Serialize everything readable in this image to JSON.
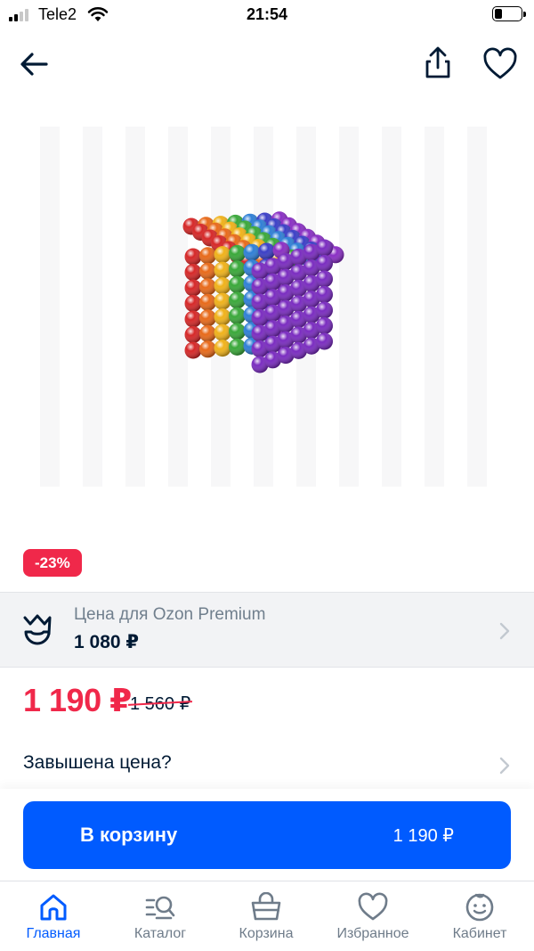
{
  "status_bar": {
    "carrier": "Tele2",
    "time": "21:54",
    "battery_level": 0.3
  },
  "top_bar": {
    "back_icon": "arrow-left-icon",
    "share_icon": "share-icon",
    "favorite_icon": "heart-icon"
  },
  "product": {
    "image": "magnetic-balls-cube",
    "discount_badge": "-23%"
  },
  "premium": {
    "label": "Цена для Ozon Premium",
    "price": "1 080 ₽"
  },
  "pricing": {
    "current": "1 190 ₽",
    "old": "1 560 ₽"
  },
  "overpriced_link": "Завышена цена?",
  "cart": {
    "button_label": "В корзину",
    "button_price": "1 190 ₽"
  },
  "tabbar": {
    "tabs": [
      {
        "label": "Главная",
        "icon": "home-icon",
        "active": true
      },
      {
        "label": "Каталог",
        "icon": "catalog-search-icon",
        "active": false
      },
      {
        "label": "Корзина",
        "icon": "basket-icon",
        "active": false
      },
      {
        "label": "Избранное",
        "icon": "heart-icon",
        "active": false
      },
      {
        "label": "Кабинет",
        "icon": "profile-smile-icon",
        "active": false
      }
    ]
  },
  "colors": {
    "accent": "#005bff",
    "discount": "#f0284a",
    "text": "#001a34",
    "muted": "#707f8d"
  }
}
